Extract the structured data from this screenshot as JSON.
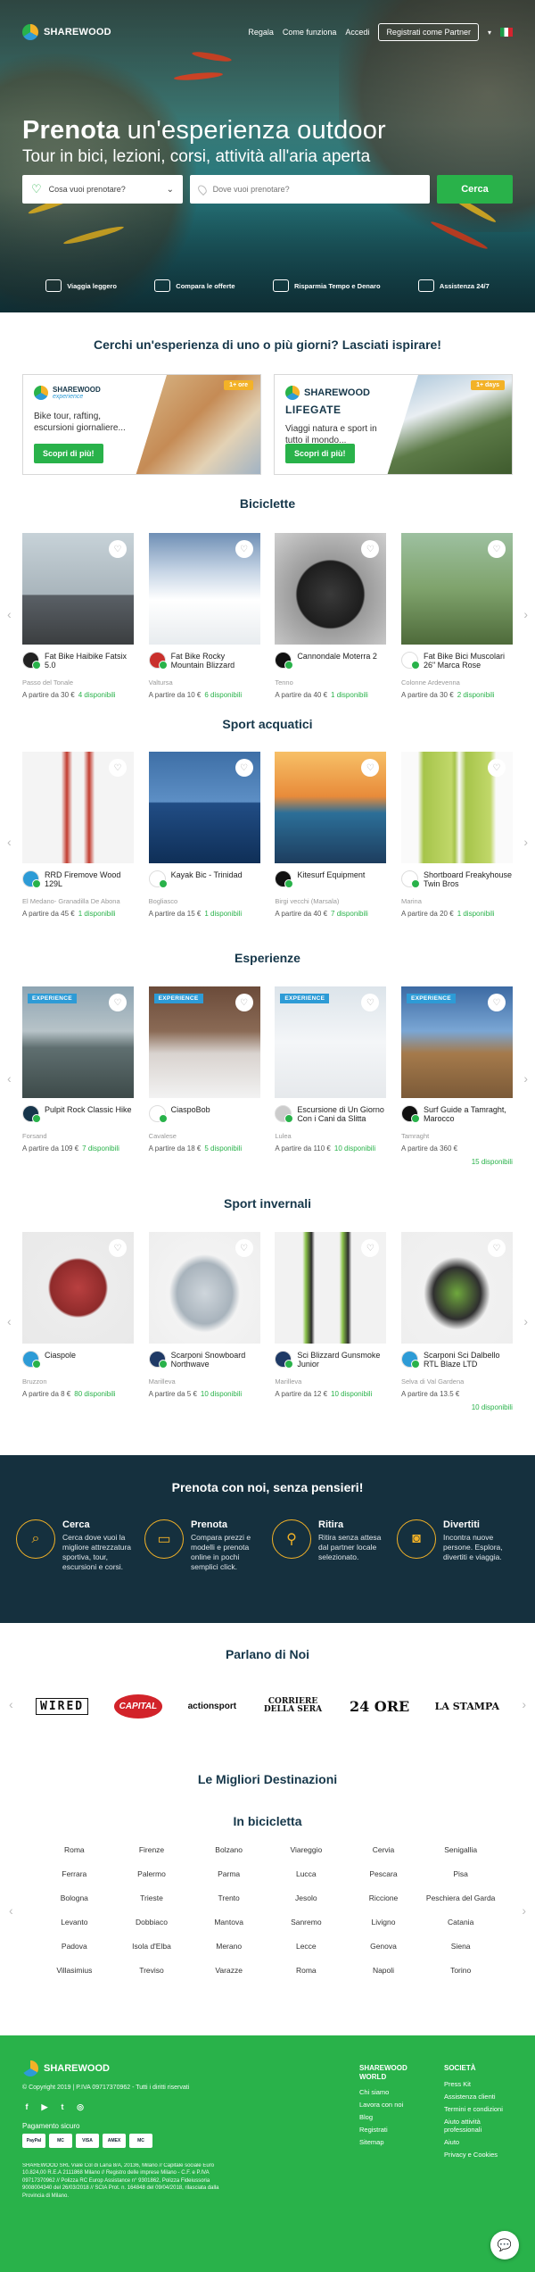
{
  "header": {
    "brand": "SHAREWOOD",
    "nav": [
      "Regala",
      "Come funziona",
      "Accedi"
    ],
    "partner_button": "Registrati come Partner",
    "language_flag": "it-flag-icon"
  },
  "hero": {
    "title_bold": "Prenota",
    "title_light": " un'esperienza outdoor",
    "subtitle": "Tour in bici, lezioni, corsi, attività all'aria aperta",
    "category_placeholder": "Cosa vuoi prenotare?",
    "where_placeholder": "Dove vuoi prenotare?",
    "search_button": "Cerca",
    "features": [
      "Viaggia leggero",
      "Compara le offerte",
      "Risparmia Tempo e Denaro",
      "Assistenza 24/7"
    ]
  },
  "inspire": {
    "title": "Cerchi un'esperienza di uno o più giorni? Lasciati ispirare!",
    "promo1": {
      "brand": "SHAREWOOD",
      "brand_sub": "experience",
      "tag": "1+ ore",
      "text": "Bike tour, rafting, escursioni giornaliere...",
      "button": "Scopri di più!"
    },
    "promo2": {
      "brand": "SHAREWOOD",
      "brand_sub": "LIFEGATE",
      "tag": "1+ days",
      "text": "Viaggi natura e sport in tutto il mondo...",
      "button": "Scopri di più!"
    }
  },
  "sections": {
    "biciclette": {
      "title": "Biciclette",
      "items": [
        {
          "name": "Fat Bike Haibike Fatsix 5.0",
          "loc": "Passo del Tonale",
          "price": "A partire da 30 €",
          "avail": "4 disponibili"
        },
        {
          "name": "Fat Bike Rocky Mountain Blizzard",
          "loc": "Valtursa",
          "price": "A partire da 10 €",
          "avail": "6 disponibili"
        },
        {
          "name": "Cannondale Moterra 2",
          "loc": "Tenno",
          "price": "A partire da 40 €",
          "avail": "1 disponibili"
        },
        {
          "name": "Fat Bike Bici Muscolari 26\" Marca Rose",
          "loc": "Colonne Ardevenna",
          "price": "A partire da 30 €",
          "avail": "2 disponibili"
        }
      ]
    },
    "acquatici": {
      "title": "Sport acquatici",
      "items": [
        {
          "name": "RRD Firemove Wood 129L",
          "loc": "El Medano- Granadilla De Abona",
          "price": "A partire da 45 €",
          "avail": "1 disponibili"
        },
        {
          "name": "Kayak Bic - Trinidad",
          "loc": "Bogliasco",
          "price": "A partire da 15 €",
          "avail": "1 disponibili"
        },
        {
          "name": "Kitesurf Equipment",
          "loc": "Birgi vecchi (Marsala)",
          "price": "A partire da 40 €",
          "avail": "7 disponibili"
        },
        {
          "name": "Shortboard Freakyhouse Twin Bros",
          "loc": "Marina",
          "price": "A partire da 20 €",
          "avail": "1 disponibili"
        }
      ]
    },
    "esperienze": {
      "title": "Esperienze",
      "badge": "EXPERIENCE",
      "items": [
        {
          "name": "Pulpit Rock Classic Hike",
          "loc": "Forsand",
          "price": "A partire da 109 €",
          "avail": "7 disponibili"
        },
        {
          "name": "CiaspoBob",
          "loc": "Cavalese",
          "price": "A partire da 18 €",
          "avail": "5 disponibili"
        },
        {
          "name": "Escursione di Un Giorno Con i Cani da Slitta",
          "loc": "Lulea",
          "price": "A partire da 110 €",
          "avail": "10 disponibili"
        },
        {
          "name": "Surf Guide a Tamraght, Marocco",
          "loc": "Tamraght",
          "price": "A partire da 360 €",
          "avail": "15 disponibili"
        }
      ]
    },
    "invernali": {
      "title": "Sport invernali",
      "items": [
        {
          "name": "Ciaspole",
          "loc": "Bruzzon",
          "price": "A partire da 8 €",
          "avail": "80 disponibili"
        },
        {
          "name": "Scarponi Snowboard Northwave",
          "loc": "Marilleva",
          "price": "A partire da 5 €",
          "avail": "10 disponibili"
        },
        {
          "name": "Sci Blizzard Gunsmoke Junior",
          "loc": "Marilleva",
          "price": "A partire da 12 €",
          "avail": "10 disponibili"
        },
        {
          "name": "Scarponi Sci Dalbello RTL Blaze LTD",
          "loc": "Selva di Val Gardena",
          "price": "A partire da 13.5 €",
          "avail": "10 disponibili"
        }
      ]
    }
  },
  "band": {
    "title": "Prenota con noi, senza pensieri!",
    "items": [
      {
        "title": "Cerca",
        "text": "Cerca dove vuoi la migliore attrezzatura sportiva, tour, escursioni e corsi."
      },
      {
        "title": "Prenota",
        "text": "Compara prezzi e modelli e prenota online in pochi semplici click."
      },
      {
        "title": "Ritira",
        "text": "Ritira senza attesa dal partner locale selezionato."
      },
      {
        "title": "Divertiti",
        "text": "Incontra nuove persone. Esplora, divertiti e viaggia."
      }
    ]
  },
  "press": {
    "title": "Parlano di Noi",
    "logos": [
      "WIRED",
      "CAPITAL",
      "actionsport",
      "CORRIERE DELLA SERA",
      "24 ORE",
      "LA STAMPA"
    ]
  },
  "destinations": {
    "title": "Le Migliori Destinazioni",
    "subtitle": "In bicicletta",
    "cities": [
      "Roma",
      "Firenze",
      "Bolzano",
      "Viareggio",
      "Cervia",
      "Senigallia",
      "Ferrara",
      "Palermo",
      "Parma",
      "Lucca",
      "Pescara",
      "Pisa",
      "Bologna",
      "Trieste",
      "Trento",
      "Jesolo",
      "Riccione",
      "Peschiera del Garda",
      "Levanto",
      "Dobbiaco",
      "Mantova",
      "Sanremo",
      "Livigno",
      "Catania",
      "Padova",
      "Isola d'Elba",
      "Merano",
      "Lecce",
      "Genova",
      "Siena",
      "Villasimius",
      "Treviso",
      "Varazze",
      "Roma",
      "Napoli",
      "Torino"
    ]
  },
  "footer": {
    "brand": "SHAREWOOD",
    "copyright": "© Copyright 2019 | P.IVA 09717370962 - Tutti i diritti riservati",
    "payment_label": "Pagamento sicuro",
    "cards": [
      "PayPal",
      "MC",
      "VISA",
      "AMEX",
      "MC"
    ],
    "legal": "SHAREWOOD SRL Viale Col di Lana 8/A, 20136, Milano // Capitale sociale Euro 10.824,00 R.E.A 2111868 Milano // Registro delle imprese Milano - C.F. e P.IVA 09717370962 // Polizza RC Europ Assistance n° 9301862, Polizza Fideiussoria 9008004340 del 26/03/2018 // SCIA Prot. n. 164848 del 09/04/2018, rilasciata dalla Provincia di Milano.",
    "col1_title": "SHAREWOOD WORLD",
    "col1": [
      "Chi siamo",
      "Lavora con noi",
      "Blog",
      "Registrati",
      "Sitemap"
    ],
    "col2_title": "SOCIETÀ",
    "col2": [
      "Press Kit",
      "Assistenza clienti",
      "Termini e condizioni",
      "Aiuto attività professionali",
      "Aiuto",
      "Privacy e Cookies"
    ]
  }
}
